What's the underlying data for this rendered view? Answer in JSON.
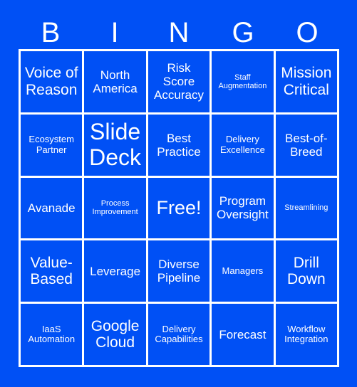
{
  "card": {
    "background_color": "#0050f5",
    "text_color": "#ffffff",
    "border_color": "#ffffff",
    "header_letters": [
      "B",
      "I",
      "N",
      "G",
      "O"
    ],
    "columns": 5,
    "rows": 5,
    "cells": [
      {
        "text": "Voice of Reason",
        "size": "l"
      },
      {
        "text": "North America",
        "size": "m"
      },
      {
        "text": "Risk Score Accuracy",
        "size": "m"
      },
      {
        "text": "Staff Augmentation",
        "size": "xs"
      },
      {
        "text": "Mission Critical",
        "size": "l"
      },
      {
        "text": "Ecosystem Partner",
        "size": "s"
      },
      {
        "text": "Slide Deck",
        "size": "xxl"
      },
      {
        "text": "Best Practice",
        "size": "m"
      },
      {
        "text": "Delivery Excellence",
        "size": "s"
      },
      {
        "text": "Best-of-Breed",
        "size": "m"
      },
      {
        "text": "Avanade",
        "size": "m"
      },
      {
        "text": "Process Improvement",
        "size": "xs"
      },
      {
        "text": "Free!",
        "size": "xl"
      },
      {
        "text": "Program Oversight",
        "size": "m"
      },
      {
        "text": "Streamlining",
        "size": "xs"
      },
      {
        "text": "Value-Based",
        "size": "l"
      },
      {
        "text": "Leverage",
        "size": "m"
      },
      {
        "text": "Diverse Pipeline",
        "size": "m"
      },
      {
        "text": "Managers",
        "size": "s"
      },
      {
        "text": "Drill Down",
        "size": "l"
      },
      {
        "text": "IaaS Automation",
        "size": "s"
      },
      {
        "text": "Google Cloud",
        "size": "l"
      },
      {
        "text": "Delivery Capabilities",
        "size": "s"
      },
      {
        "text": "Forecast",
        "size": "m"
      },
      {
        "text": "Workflow Integration",
        "size": "s"
      }
    ]
  }
}
